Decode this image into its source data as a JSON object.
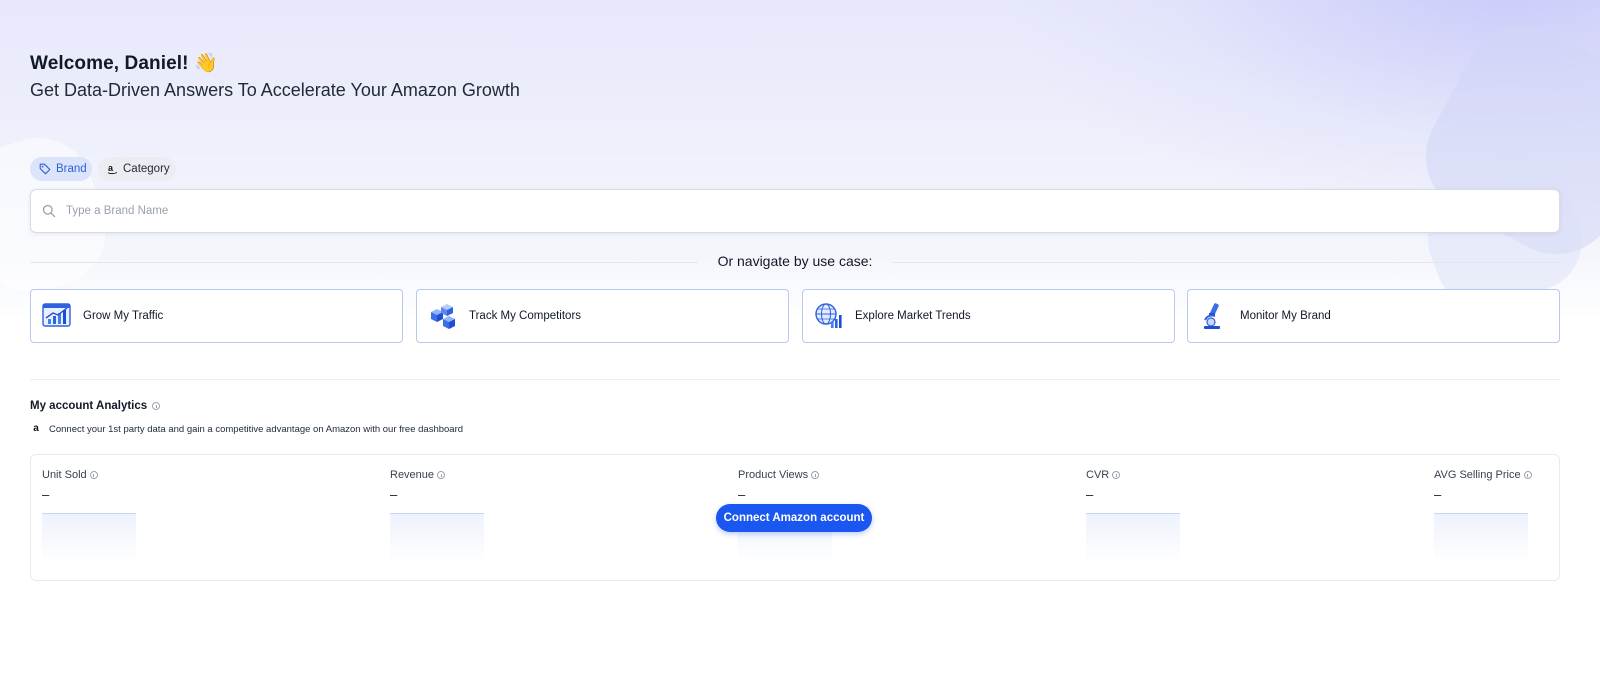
{
  "colors": {
    "accent": "#1a56f0",
    "brand_pill_bg": "#dbe4fb",
    "brand_pill_text": "#2f5fd8",
    "card_border": "#b8c8ee"
  },
  "header": {
    "welcome": "Welcome, Daniel! 👋",
    "subtitle": "Get Data-Driven Answers To Accelerate Your Amazon Growth"
  },
  "search_tabs": [
    {
      "label": "Brand",
      "icon": "tag-icon",
      "active": true
    },
    {
      "label": "Category",
      "icon": "amazon-icon",
      "active": false
    }
  ],
  "search": {
    "placeholder": "Type a Brand Name",
    "value": ""
  },
  "navigate": {
    "heading": "Or navigate by use case:",
    "use_cases": [
      {
        "label": "Grow My Traffic",
        "icon": "growth-chart-icon"
      },
      {
        "label": "Track My Competitors",
        "icon": "competitor-boxes-icon"
      },
      {
        "label": "Explore Market Trends",
        "icon": "globe-chart-icon"
      },
      {
        "label": "Monitor My Brand",
        "icon": "microscope-icon"
      }
    ]
  },
  "analytics": {
    "title": "My account Analytics",
    "subtitle": "Connect your 1st party data and gain a competitive advantage on Amazon with our free dashboard",
    "metrics": [
      {
        "label": "Unit Sold",
        "value": "–"
      },
      {
        "label": "Revenue",
        "value": "–"
      },
      {
        "label": "Product Views",
        "value": "–"
      },
      {
        "label": "CVR",
        "value": "–"
      },
      {
        "label": "AVG Selling Price",
        "value": "–"
      }
    ],
    "connect_button": "Connect Amazon account"
  }
}
